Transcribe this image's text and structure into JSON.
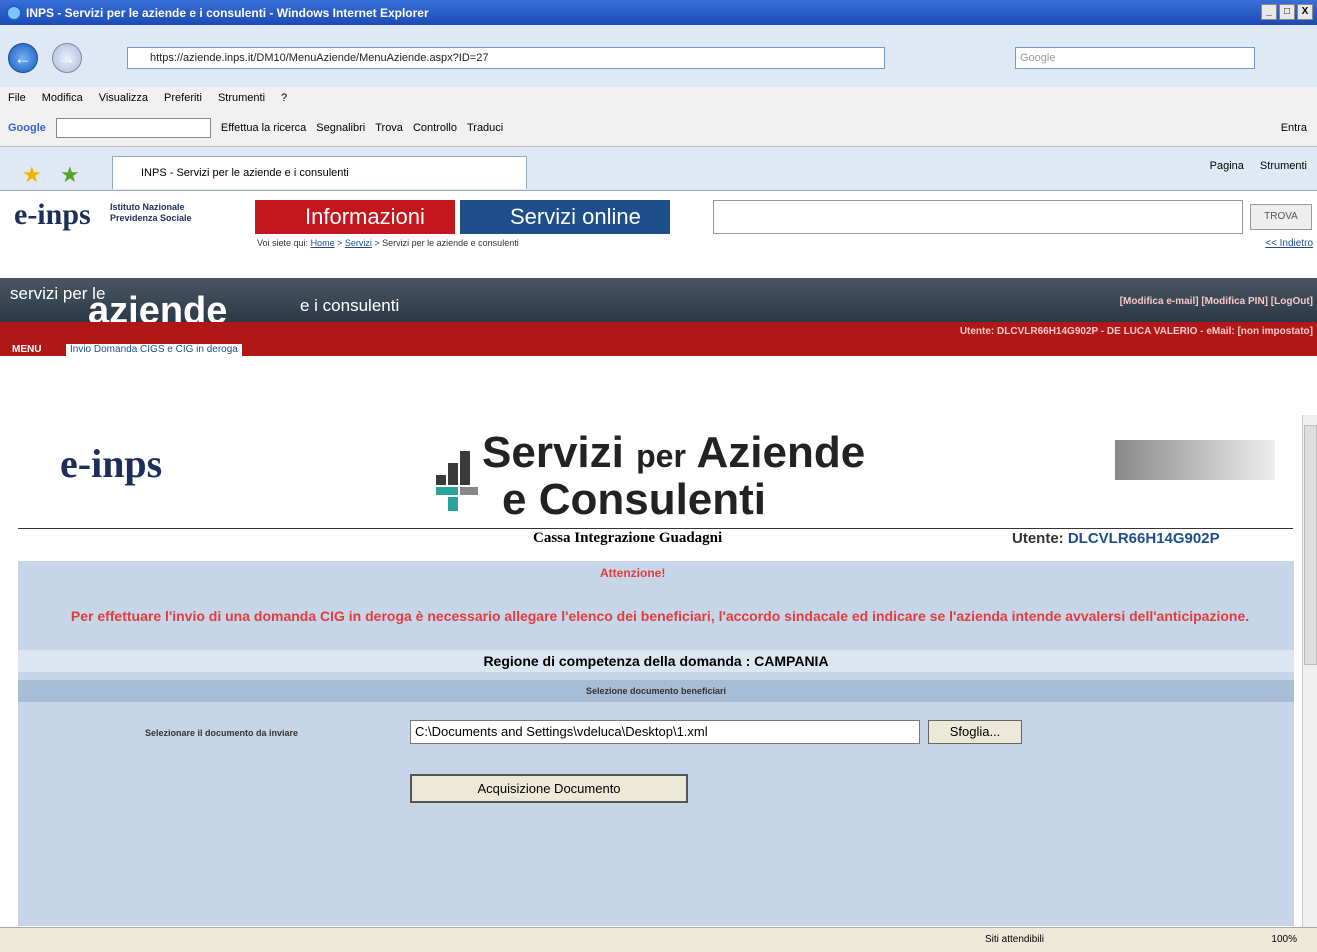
{
  "window": {
    "title": "INPS - Servizi per le aziende e i consulenti - Windows Internet Explorer",
    "controls": [
      "_",
      "□",
      "X"
    ]
  },
  "browser": {
    "back": "←",
    "forward": "→",
    "url": "https://aziende.inps.it/DM10/MenuAziende/MenuAziende.aspx?ID=27",
    "search_placeholder": "Google",
    "menu": [
      "File",
      "Modifica",
      "Visualizza",
      "Preferiti",
      "Strumenti",
      "?"
    ],
    "google": {
      "logo": "Google",
      "search": "Effettua la ricerca",
      "bookmarks": "Segnalibri",
      "find": "Trova",
      "check": "Controllo",
      "translate": "Traduci",
      "signin": "Entra"
    },
    "tab": "INPS - Servizi per le aziende e i consulenti",
    "tools": [
      "Pagina",
      "Strumenti"
    ]
  },
  "inps": {
    "logo": "e-inps",
    "institute": [
      "Istituto Nazionale",
      "Previdenza Sociale"
    ],
    "tab_info": "Informazioni",
    "tab_serv": "Servizi online",
    "trova": "TROVA",
    "breadcrumb_prefix": "Voi siete qui:",
    "crumb_home": "Home",
    "crumb_servizi": "Servizi",
    "crumb_current": "Servizi per le aziende e consulenti",
    "indietro": "<< Indietro"
  },
  "banner": {
    "servizi": "servizi per le",
    "aziende": "aziende",
    "consulenti": "e i consulenti",
    "links": "[Modifica e-mail] [Modifica PIN] [LogOut]",
    "user": "Utente: DLCVLR66H14G902P - DE LUCA VALERIO - eMail: [non impostato]",
    "menu": "MENU",
    "menu_link": "Invio Domanda CIGS e CIG in deroga"
  },
  "page": {
    "logo": "e-inps",
    "title_line1": "Servizi",
    "title_per": "per",
    "title_aziende": "Aziende",
    "title_line2": "e Consulenti",
    "cassa": "Cassa Integrazione Guadagni",
    "utente_label": "Utente:",
    "utente": "DLCVLR66H14G902P",
    "attenzione": "Attenzione!",
    "message": "Per effettuare l'invio di una domanda CIG in deroga è necessario allegare l'elenco dei beneficiari, l'accordo sindacale ed indicare se l'azienda intende avvalersi dell'anticipazione.",
    "regione": "Regione di competenza della domanda : CAMPANIA",
    "selezione": "Selezione documento beneficiari",
    "sel_label": "Selezionare il documento da inviare",
    "file_value": "C:\\Documents and Settings\\vdeluca\\Desktop\\1.xml",
    "browse": "Sfoglia...",
    "acquisizione": "Acquisizione Documento"
  },
  "status": {
    "sites": "Siti attendibili",
    "zoom": "100%"
  }
}
